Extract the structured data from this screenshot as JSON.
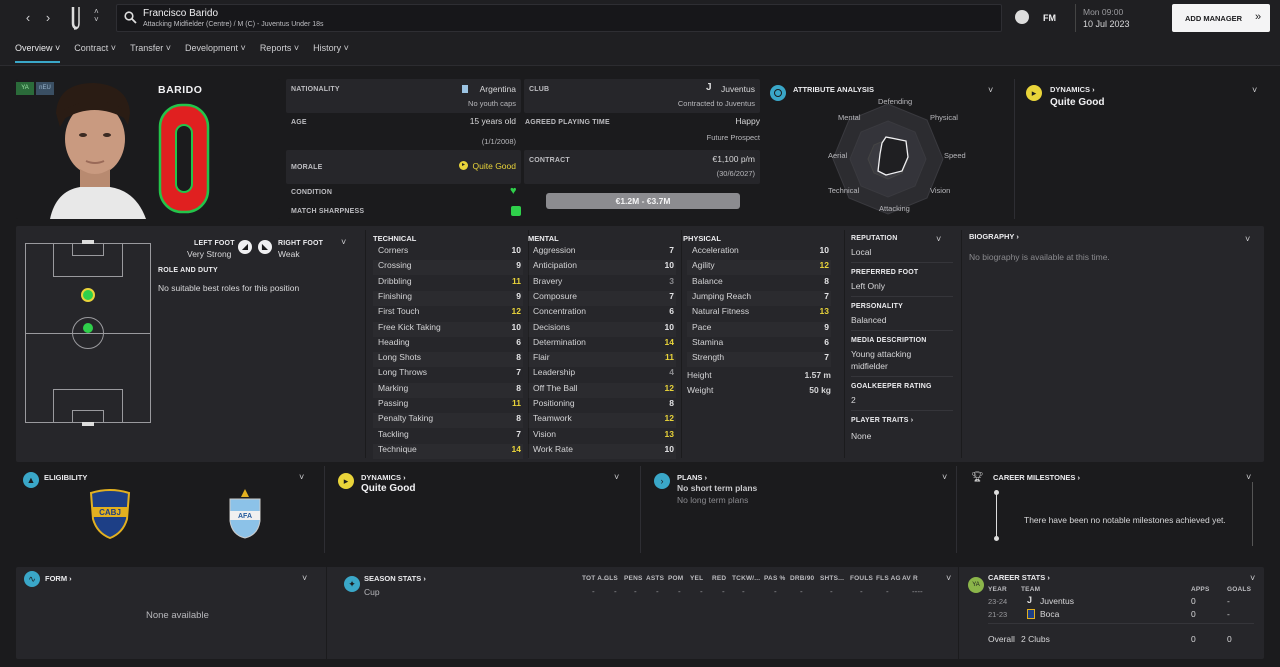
{
  "header": {
    "player_name": "Francisco Barido",
    "player_subtitle": "Attacking Midfielder (Centre) / M (C) - Juventus Under 18s",
    "fm_label": "FM",
    "day_time": "Mon 09:00",
    "date": "10 Jul 2023",
    "add_manager": "ADD MANAGER"
  },
  "tabs": [
    "Overview",
    "Contract",
    "Transfer",
    "Development",
    "Reports",
    "History"
  ],
  "badges": [
    "YA",
    "nEU"
  ],
  "kit": {
    "surname": "BARIDO",
    "number": "0"
  },
  "info": {
    "nationality_label": "NATIONALITY",
    "nationality": "Argentina",
    "youth_caps": "No youth caps",
    "age_label": "AGE",
    "age": "15 years old",
    "dob": "(1/1/2008)",
    "morale_label": "MORALE",
    "morale": "Quite Good",
    "condition_label": "CONDITION",
    "sharpness_label": "MATCH SHARPNESS",
    "club_label": "CLUB",
    "club": "Juventus",
    "contracted_to": "Contracted to Juventus",
    "playing_time_label": "AGREED PLAYING TIME",
    "happy": "Happy",
    "future_prospect": "Future Prospect",
    "contract_label": "CONTRACT",
    "wage": "€1,100 p/m",
    "contract_end": "(30/6/2027)",
    "value_range": "€1.2M - €3.7M"
  },
  "attribute_analysis": {
    "title": "ATTRIBUTE ANALYSIS",
    "labels": [
      "Defending",
      "Physical",
      "Speed",
      "Vision",
      "Attacking",
      "Technical",
      "Aerial",
      "Mental"
    ]
  },
  "dynamics_top": {
    "title": "DYNAMICS",
    "value": "Quite Good"
  },
  "feet": {
    "left_label": "LEFT FOOT",
    "left_value": "Very Strong",
    "right_label": "RIGHT FOOT",
    "right_value": "Weak"
  },
  "role": {
    "title": "ROLE AND DUTY",
    "text": "No suitable best roles for this position"
  },
  "technical": {
    "title": "TECHNICAL",
    "rows": [
      {
        "n": "Corners",
        "v": "10",
        "c": "w"
      },
      {
        "n": "Crossing",
        "v": "9",
        "c": "w"
      },
      {
        "n": "Dribbling",
        "v": "11",
        "c": "y"
      },
      {
        "n": "Finishing",
        "v": "9",
        "c": "w"
      },
      {
        "n": "First Touch",
        "v": "12",
        "c": "y"
      },
      {
        "n": "Free Kick Taking",
        "v": "10",
        "c": "w"
      },
      {
        "n": "Heading",
        "v": "6",
        "c": "w"
      },
      {
        "n": "Long Shots",
        "v": "8",
        "c": "w"
      },
      {
        "n": "Long Throws",
        "v": "7",
        "c": "w"
      },
      {
        "n": "Marking",
        "v": "8",
        "c": "w"
      },
      {
        "n": "Passing",
        "v": "11",
        "c": "y"
      },
      {
        "n": "Penalty Taking",
        "v": "8",
        "c": "w"
      },
      {
        "n": "Tackling",
        "v": "7",
        "c": "w"
      },
      {
        "n": "Technique",
        "v": "14",
        "c": "y"
      }
    ]
  },
  "mental": {
    "title": "MENTAL",
    "rows": [
      {
        "n": "Aggression",
        "v": "7",
        "c": "w"
      },
      {
        "n": "Anticipation",
        "v": "10",
        "c": "w"
      },
      {
        "n": "Bravery",
        "v": "3",
        "c": "g"
      },
      {
        "n": "Composure",
        "v": "7",
        "c": "w"
      },
      {
        "n": "Concentration",
        "v": "6",
        "c": "w"
      },
      {
        "n": "Decisions",
        "v": "10",
        "c": "w"
      },
      {
        "n": "Determination",
        "v": "14",
        "c": "y"
      },
      {
        "n": "Flair",
        "v": "11",
        "c": "y"
      },
      {
        "n": "Leadership",
        "v": "4",
        "c": "g"
      },
      {
        "n": "Off The Ball",
        "v": "12",
        "c": "y"
      },
      {
        "n": "Positioning",
        "v": "8",
        "c": "w"
      },
      {
        "n": "Teamwork",
        "v": "12",
        "c": "y"
      },
      {
        "n": "Vision",
        "v": "13",
        "c": "y"
      },
      {
        "n": "Work Rate",
        "v": "10",
        "c": "w"
      }
    ]
  },
  "physical": {
    "title": "PHYSICAL",
    "rows": [
      {
        "n": "Acceleration",
        "v": "10",
        "c": "w"
      },
      {
        "n": "Agility",
        "v": "12",
        "c": "y"
      },
      {
        "n": "Balance",
        "v": "8",
        "c": "w"
      },
      {
        "n": "Jumping Reach",
        "v": "7",
        "c": "w"
      },
      {
        "n": "Natural Fitness",
        "v": "13",
        "c": "y"
      },
      {
        "n": "Pace",
        "v": "9",
        "c": "w"
      },
      {
        "n": "Stamina",
        "v": "6",
        "c": "w"
      },
      {
        "n": "Strength",
        "v": "7",
        "c": "w"
      }
    ],
    "height_label": "Height",
    "height": "1.57 m",
    "weight_label": "Weight",
    "weight": "50 kg"
  },
  "profile": {
    "reputation_label": "REPUTATION",
    "reputation": "Local",
    "foot_label": "PREFERRED FOOT",
    "foot": "Left Only",
    "personality_label": "PERSONALITY",
    "personality": "Balanced",
    "media_label": "MEDIA DESCRIPTION",
    "media": "Young attacking midfielder",
    "gk_label": "GOALKEEPER RATING",
    "gk": "2",
    "traits_label": "PLAYER TRAITS",
    "traits": "None"
  },
  "biography": {
    "title": "BIOGRAPHY",
    "text": "No biography is available at this time."
  },
  "eligibility": {
    "title": "ELIGIBILITY",
    "club_crest": "CABJ",
    "nation_crest": "AFA"
  },
  "dynamics_mid": {
    "title": "DYNAMICS",
    "value": "Quite Good"
  },
  "plans": {
    "title": "PLANS",
    "short": "No short term plans",
    "long": "No long term plans"
  },
  "milestones": {
    "title": "CAREER MILESTONES",
    "text": "There have been no notable milestones achieved yet."
  },
  "form": {
    "title": "FORM",
    "text": "None available"
  },
  "season_stats": {
    "title": "SEASON STATS",
    "columns": [
      "TOT A...",
      "GLS",
      "PENS",
      "ASTS",
      "POM",
      "YEL",
      "RED",
      "TCKW/...",
      "PAS %",
      "DRB/90",
      "SHTS...",
      "FOULS",
      "FLS AG",
      "AV R"
    ],
    "row_label": "Cup",
    "row_values": [
      "-",
      "-",
      "-",
      "-",
      "-",
      "-",
      "-",
      "-",
      "-",
      "-",
      "-",
      "-",
      "-",
      "----"
    ]
  },
  "career_stats": {
    "title": "CAREER STATS",
    "col_year": "YEAR",
    "col_team": "TEAM",
    "col_apps": "APPS",
    "col_goals": "GOALS",
    "rows": [
      {
        "year": "23-24",
        "team": "Juventus",
        "apps": "0",
        "goals": "-"
      },
      {
        "year": "21-23",
        "team": "Boca",
        "apps": "0",
        "goals": "-"
      }
    ],
    "overall_label": "Overall",
    "overall_clubs": "2 Clubs",
    "overall_apps": "0",
    "overall_goals": "0"
  },
  "colors": {
    "accent": "#3aa7c8",
    "yellow": "#e9d43a",
    "green": "#2fd04b",
    "kit_red": "#e02020"
  }
}
